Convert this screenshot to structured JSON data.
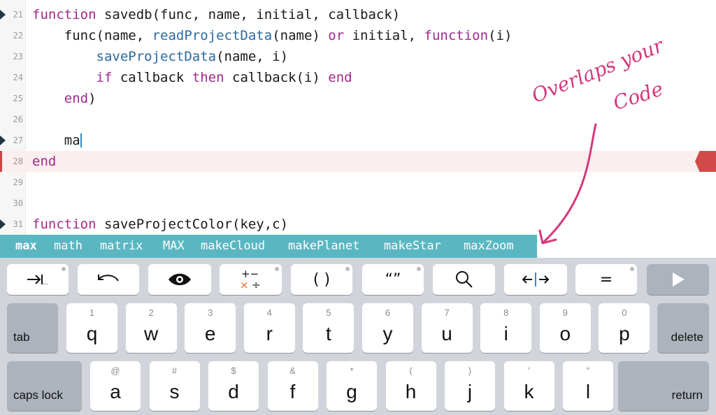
{
  "editor": {
    "lines": [
      {
        "num": "21",
        "tokens": [
          {
            "t": "function",
            "c": "kw"
          },
          {
            "t": " savedb(func, name, initial, callback)",
            "c": ""
          }
        ]
      },
      {
        "num": "22",
        "tokens": [
          {
            "t": "    func(name, ",
            "c": ""
          },
          {
            "t": "readProjectData",
            "c": "fn"
          },
          {
            "t": "(name) ",
            "c": ""
          },
          {
            "t": "or",
            "c": "kw"
          },
          {
            "t": " initial, ",
            "c": ""
          },
          {
            "t": "function",
            "c": "kw"
          },
          {
            "t": "(i)",
            "c": ""
          }
        ]
      },
      {
        "num": "23",
        "tokens": [
          {
            "t": "        ",
            "c": ""
          },
          {
            "t": "saveProjectData",
            "c": "fn"
          },
          {
            "t": "(name, i)",
            "c": ""
          }
        ]
      },
      {
        "num": "24",
        "tokens": [
          {
            "t": "        ",
            "c": ""
          },
          {
            "t": "if",
            "c": "kw"
          },
          {
            "t": " callback ",
            "c": ""
          },
          {
            "t": "then",
            "c": "kw"
          },
          {
            "t": " callback(i) ",
            "c": ""
          },
          {
            "t": "end",
            "c": "kw"
          }
        ]
      },
      {
        "num": "25",
        "tokens": [
          {
            "t": "    ",
            "c": ""
          },
          {
            "t": "end",
            "c": "kw"
          },
          {
            "t": ")",
            "c": ""
          }
        ]
      },
      {
        "num": "26",
        "tokens": []
      },
      {
        "num": "27",
        "tokens": [
          {
            "t": "    ma",
            "c": ""
          }
        ]
      },
      {
        "num": "28",
        "tokens": [
          {
            "t": "end",
            "c": "kw"
          }
        ]
      },
      {
        "num": "29",
        "tokens": []
      },
      {
        "num": "30",
        "tokens": []
      },
      {
        "num": "31",
        "tokens": [
          {
            "t": "function",
            "c": "kw"
          },
          {
            "t": " saveProjectColor(key,c)",
            "c": ""
          }
        ]
      }
    ]
  },
  "annotation": {
    "line1": "Overlaps your",
    "line2": "Code"
  },
  "autocomplete": [
    "max",
    "math",
    "matrix",
    "MAX",
    "makeCloud",
    "makePlanet",
    "makeStar",
    "maxZoom"
  ],
  "toolbar": {
    "tab_indent_icon": "tab-indent-icon",
    "undo_icon": "undo-icon",
    "eye_icon": "eye-icon",
    "math_ops_icon": "math-operators-icon",
    "parens_label": "( )",
    "quotes_label": "“”",
    "search_icon": "search-icon",
    "cursor_move_icon": "cursor-move-icon",
    "equals_label": "=",
    "play_icon": "play-icon"
  },
  "keyboard": {
    "row1": [
      {
        "hint": "1",
        "letter": "q"
      },
      {
        "hint": "2",
        "letter": "w"
      },
      {
        "hint": "3",
        "letter": "e"
      },
      {
        "hint": "4",
        "letter": "r"
      },
      {
        "hint": "5",
        "letter": "t"
      },
      {
        "hint": "6",
        "letter": "y"
      },
      {
        "hint": "7",
        "letter": "u"
      },
      {
        "hint": "8",
        "letter": "i"
      },
      {
        "hint": "9",
        "letter": "o"
      },
      {
        "hint": "0",
        "letter": "p"
      }
    ],
    "row2": [
      {
        "hint": "@",
        "letter": "a"
      },
      {
        "hint": "#",
        "letter": "s"
      },
      {
        "hint": "$",
        "letter": "d"
      },
      {
        "hint": "&",
        "letter": "f"
      },
      {
        "hint": "*",
        "letter": "g"
      },
      {
        "hint": "(",
        "letter": "h"
      },
      {
        "hint": ")",
        "letter": "j"
      },
      {
        "hint": "’",
        "letter": "k"
      },
      {
        "hint": "”",
        "letter": "l"
      }
    ],
    "tab_label": "tab",
    "delete_label": "delete",
    "caps_label": "caps lock",
    "return_label": "return"
  },
  "colors": {
    "keyword": "#a0288c",
    "function": "#2c6aa0",
    "accent": "#5ab7c2",
    "annotation": "#d4397e",
    "error": "#d14a4a"
  }
}
